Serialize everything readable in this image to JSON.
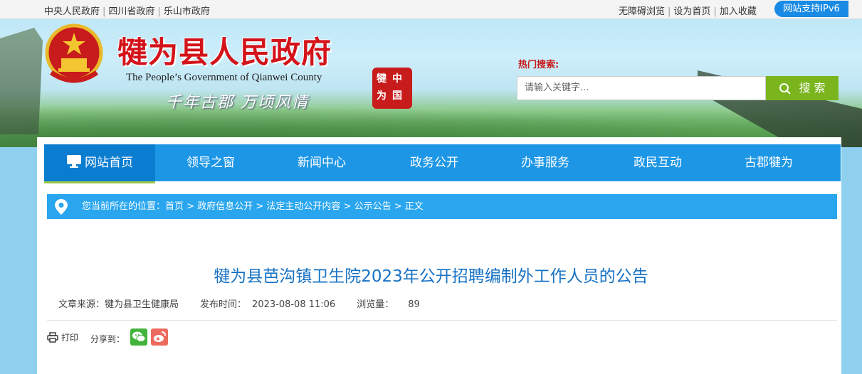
{
  "topbar": {
    "links_left": [
      "中央人民政府",
      "四川省政府",
      "乐山市政府"
    ],
    "links_right": [
      "无障碍浏览",
      "设为首页",
      "加入收藏"
    ],
    "ipv6": "网站支持IPv6"
  },
  "header": {
    "title": "犍为县人民政府",
    "subtitle": "The People’s Government of Qianwei County",
    "slogan": "千年古郡 万顷风情",
    "seal_text": [
      "犍",
      "中",
      "为",
      "国"
    ],
    "hot_search_label": "热门搜索:",
    "search_placeholder": "请输入关键字...",
    "search_button": "搜 索"
  },
  "nav": {
    "items": [
      "网站首页",
      "领导之窗",
      "新闻中心",
      "政务公开",
      "办事服务",
      "政民互动",
      "古郡犍为"
    ],
    "active_index": 0
  },
  "breadcrumb": {
    "prefix": "您当前所在的位置：",
    "items": [
      "首页",
      "政府信息公开",
      "法定主动公开内容",
      "公示公告",
      "正文"
    ],
    "separator": " > "
  },
  "article": {
    "title": "犍为县芭沟镇卫生院2023年公开招聘编制外工作人员的公告",
    "source_label": "文章来源：",
    "source": "犍为县卫生健康局",
    "date_label": "发布时间：",
    "date": "2023-08-08 11:06",
    "views_label": "浏览量：",
    "views": "89"
  },
  "tools": {
    "print": "打印",
    "share_label": "分享到："
  },
  "colors": {
    "nav": "#1d96e6",
    "nav_active": "#0a7dd0",
    "breadcrumb": "#2aa6ee",
    "title": "#1772c4",
    "brand_red": "#d3131a",
    "search_button": "#7ab51d"
  },
  "icons": [
    "home-monitor-icon",
    "location-pin-icon",
    "search-icon",
    "print-icon",
    "wechat-icon",
    "weibo-icon"
  ]
}
